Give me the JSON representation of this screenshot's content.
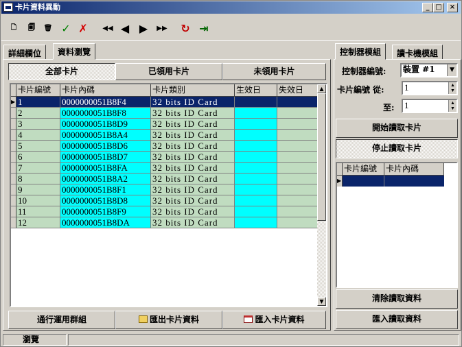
{
  "window": {
    "title": "卡片資料異動",
    "controls": {
      "minimize": "_",
      "maximize": "□",
      "close": "×"
    }
  },
  "toolbar": {
    "buttons": [
      {
        "name": "new",
        "glyph": "🗋",
        "color": "#000000"
      },
      {
        "name": "edit",
        "glyph": "🗐",
        "color": "#000000"
      },
      {
        "name": "delete",
        "glyph": "🗑",
        "color": "#000000"
      },
      {
        "name": "confirm",
        "glyph": "✓",
        "color": "#008000"
      },
      {
        "name": "cancel",
        "glyph": "✗",
        "color": "#d40000"
      },
      {
        "name": "first",
        "glyph": "◀◀",
        "color": "#000000"
      },
      {
        "name": "prev",
        "glyph": "◀",
        "color": "#000000"
      },
      {
        "name": "next",
        "glyph": "▶",
        "color": "#000000"
      },
      {
        "name": "last",
        "glyph": "▶▶",
        "color": "#000000"
      },
      {
        "name": "refresh",
        "glyph": "↻",
        "color": "#c00000"
      },
      {
        "name": "exit",
        "glyph": "⇥",
        "color": "#006400"
      }
    ]
  },
  "left_tabs": {
    "detail": "詳細欄位",
    "browse": "資料瀏覽"
  },
  "filter_buttons": {
    "all": "全部卡片",
    "used": "已領用卡片",
    "unused": "未領用卡片"
  },
  "grid": {
    "headers": [
      "卡片編號",
      "卡片內碼",
      "卡片類別",
      "生效日",
      "失效日"
    ],
    "rows": [
      {
        "no": "1",
        "code": "0000000051B8F4",
        "type": "32 bits ID Card",
        "start": "",
        "end": ""
      },
      {
        "no": "2",
        "code": "0000000051B8F8",
        "type": "32 bits ID Card",
        "start": "",
        "end": ""
      },
      {
        "no": "3",
        "code": "0000000051B8D9",
        "type": "32 bits ID Card",
        "start": "",
        "end": ""
      },
      {
        "no": "4",
        "code": "0000000051B8A4",
        "type": "32 bits ID Card",
        "start": "",
        "end": ""
      },
      {
        "no": "5",
        "code": "0000000051B8D6",
        "type": "32 bits ID Card",
        "start": "",
        "end": ""
      },
      {
        "no": "6",
        "code": "0000000051B8D7",
        "type": "32 bits ID Card",
        "start": "",
        "end": ""
      },
      {
        "no": "7",
        "code": "0000000051B8FA",
        "type": "32 bits ID Card",
        "start": "",
        "end": ""
      },
      {
        "no": "8",
        "code": "0000000051B8A2",
        "type": "32 bits ID Card",
        "start": "",
        "end": ""
      },
      {
        "no": "9",
        "code": "0000000051B8F1",
        "type": "32 bits ID Card",
        "start": "",
        "end": ""
      },
      {
        "no": "10",
        "code": "0000000051B8D8",
        "type": "32 bits ID Card",
        "start": "",
        "end": ""
      },
      {
        "no": "11",
        "code": "0000000051B8F9",
        "type": "32 bits ID Card",
        "start": "",
        "end": ""
      },
      {
        "no": "12",
        "code": "0000000051B8DA",
        "type": "32 bits ID Card",
        "start": "",
        "end": ""
      }
    ]
  },
  "bottom_buttons": {
    "group": "通行運用群組",
    "export": "匯出卡片資料",
    "import": "匯入卡片資料"
  },
  "right_tabs": {
    "controller": "控制器模組",
    "reader": "讀卡機模組"
  },
  "controller": {
    "no_label": "控制器編號:",
    "no_value": "裝置 #1",
    "card_from_label": "卡片編號 從:",
    "card_from_value": "1",
    "card_to_label": "至:",
    "card_to_value": "1",
    "start_read": "開始讀取卡片",
    "stop_read": "停止讀取卡片"
  },
  "read_grid": {
    "headers": [
      "卡片編號",
      "卡片內碼"
    ]
  },
  "right_bottom_buttons": {
    "clear": "清除讀取資料",
    "import": "匯入讀取資料"
  },
  "status": {
    "text": "瀏覽"
  }
}
